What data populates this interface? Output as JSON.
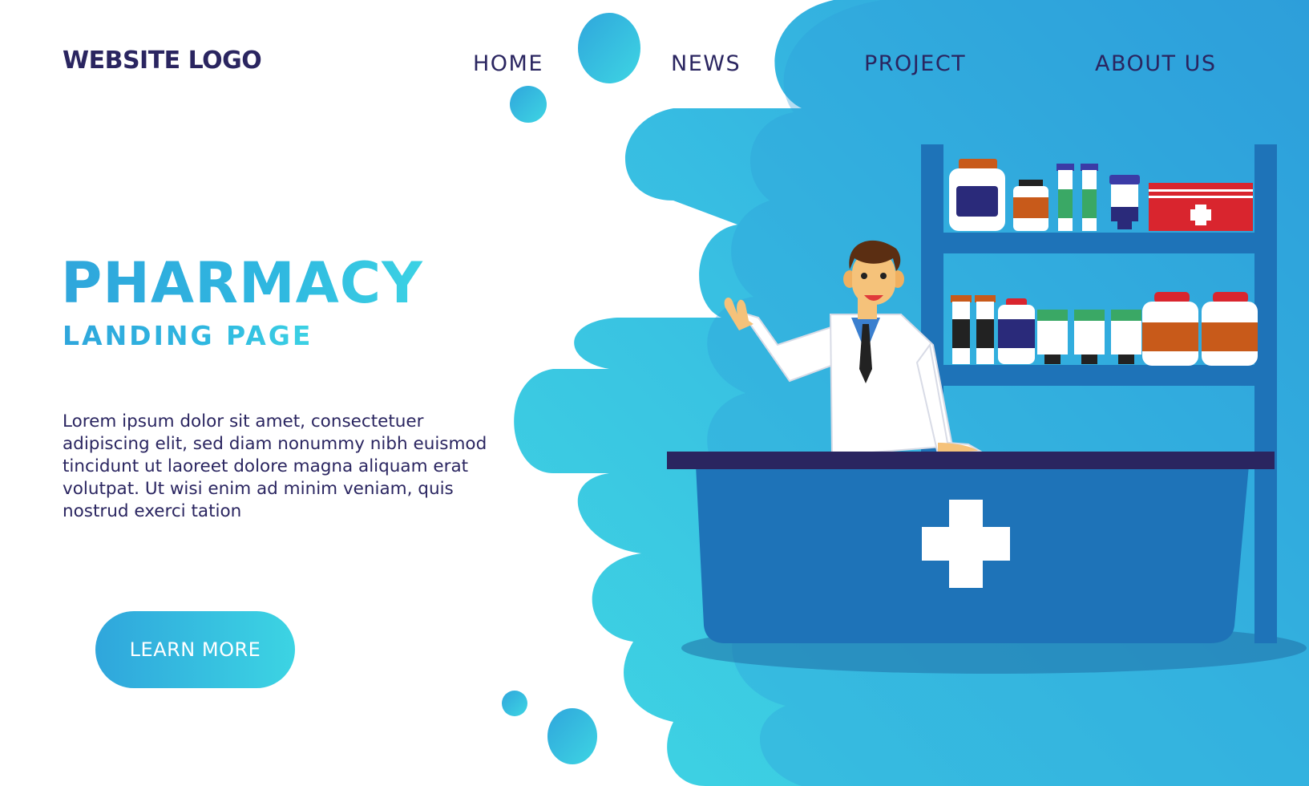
{
  "header": {
    "logo": "WEBSITE LOGO",
    "nav": [
      {
        "label": "HOME"
      },
      {
        "label": "NEWS"
      },
      {
        "label": "PROJECT"
      },
      {
        "label": "ABOUT US"
      }
    ]
  },
  "hero": {
    "title": "PHARMACY",
    "subtitle": "LANDING PAGE",
    "body": "Lorem ipsum dolor sit amet, consectetuer adipiscing elit, sed diam nonummy nibh euismod tincidunt ut laoreet dolore magna aliquam erat volutpat. Ut wisi enim ad minim veniam, quis nostrud exerci tation",
    "cta_label": "LEARN MORE"
  },
  "colors": {
    "navy": "#2a2560",
    "accent_blue": "#2fa6dc",
    "accent_cyan": "#3cd4e3",
    "counter_blue": "#1e73b8",
    "cross_red": "#d9252e"
  },
  "icons": {
    "counter_cross": "medical-cross-icon",
    "first_aid": "first-aid-kit-icon"
  }
}
